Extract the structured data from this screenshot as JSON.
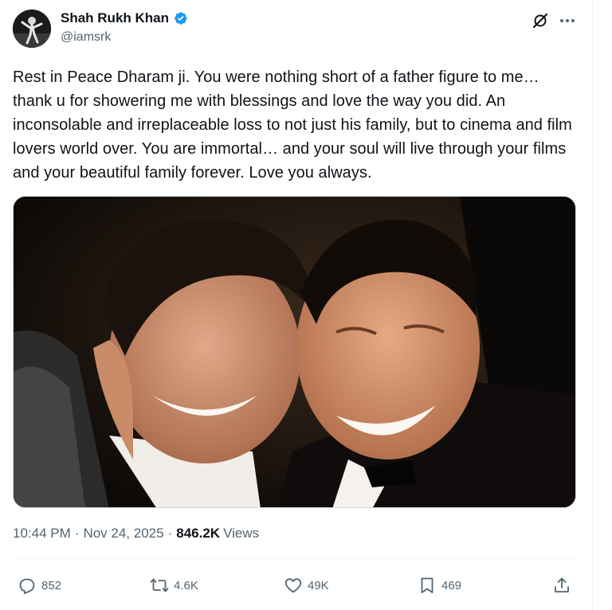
{
  "author": {
    "display_name": "Shah Rukh Khan",
    "handle": "@iamsrk",
    "verified": true,
    "verified_color": "#1d9bf0"
  },
  "tweet": {
    "text": "Rest in Peace Dharam ji. You were nothing short of a father figure to me… thank u for showering me with blessings and love the way you did. An inconsolable and irreplaceable loss to not just his family, but to cinema and film lovers world over. You are immortal… and your soul will live through your films and your beautiful family forever. Love you always."
  },
  "meta": {
    "time": "10:44 PM",
    "separator": "·",
    "date": "Nov 24, 2025",
    "views_count": "846.2K",
    "views_label": "Views"
  },
  "actions": {
    "replies": "852",
    "reposts": "4.6K",
    "likes": "49K",
    "bookmarks": "469"
  },
  "icons": {
    "verified": "verified-badge-icon",
    "grok": "grok-icon",
    "more": "more-dots-icon",
    "reply": "reply-icon",
    "repost": "repost-icon",
    "like": "heart-icon",
    "bookmark": "bookmark-icon",
    "share": "share-icon"
  },
  "colors": {
    "text_primary": "#0f1419",
    "text_secondary": "#536471",
    "border": "#eff3f4"
  }
}
